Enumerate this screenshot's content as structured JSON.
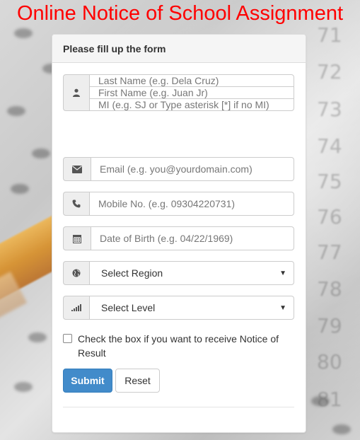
{
  "page_title": "Online Notice of School Assignment",
  "panel": {
    "heading": "Please fill up the form"
  },
  "form": {
    "name_group": {
      "icon": "user-icon",
      "last_name_placeholder": "Last Name   (e.g. Dela Cruz)",
      "first_name_placeholder": "First Name   (e.g. Juan Jr)",
      "mi_placeholder": "MI  (e.g. SJ or Type asterisk [*] if no MI)"
    },
    "email": {
      "icon": "envelope-icon",
      "placeholder": "Email  (e.g. you@yourdomain.com)"
    },
    "mobile": {
      "icon": "phone-icon",
      "placeholder": "Mobile No.  (e.g. 09304220731)"
    },
    "dob": {
      "icon": "calendar-icon",
      "placeholder": "Date of Birth  (e.g.  04/22/1969)"
    },
    "region": {
      "icon": "globe-icon",
      "selected": "Select Region"
    },
    "level": {
      "icon": "signal-icon",
      "selected": "Select Level"
    },
    "notice_checkbox": {
      "label": "Check the box if you want to receive Notice of Result",
      "checked": false
    }
  },
  "buttons": {
    "submit": "Submit",
    "reset": "Reset"
  },
  "background_numbers": [
    "71",
    "72",
    "73",
    "74",
    "75",
    "76",
    "77",
    "78",
    "79",
    "80",
    "81"
  ],
  "colors": {
    "title": "#ff0000",
    "primary": "#428bca"
  }
}
